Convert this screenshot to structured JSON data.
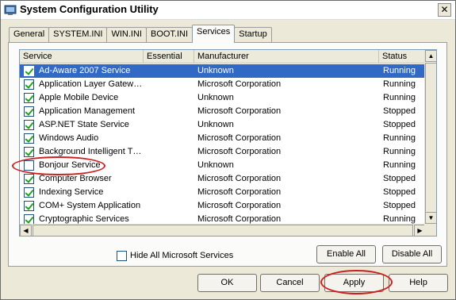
{
  "window": {
    "title": "System Configuration Utility",
    "close_glyph": "✕"
  },
  "tabs": [
    {
      "label": "General"
    },
    {
      "label": "SYSTEM.INI"
    },
    {
      "label": "WIN.INI"
    },
    {
      "label": "BOOT.INI"
    },
    {
      "label": "Services",
      "active": true
    },
    {
      "label": "Startup"
    }
  ],
  "list": {
    "columns": {
      "service": "Service",
      "essential": "Essential",
      "manufacturer": "Manufacturer",
      "status": "Status"
    },
    "rows": [
      {
        "checked": true,
        "service": "Ad-Aware 2007 Service",
        "manufacturer": "Unknown",
        "status": "Running",
        "selected": true
      },
      {
        "checked": true,
        "service": "Application Layer Gatew…",
        "manufacturer": "Microsoft Corporation",
        "status": "Running"
      },
      {
        "checked": true,
        "service": "Apple Mobile Device",
        "manufacturer": "Unknown",
        "status": "Running"
      },
      {
        "checked": true,
        "service": "Application Management",
        "manufacturer": "Microsoft Corporation",
        "status": "Stopped"
      },
      {
        "checked": true,
        "service": "ASP.NET State Service",
        "manufacturer": "Unknown",
        "status": "Stopped"
      },
      {
        "checked": true,
        "service": "Windows Audio",
        "manufacturer": "Microsoft Corporation",
        "status": "Running"
      },
      {
        "checked": true,
        "service": "Background Intelligent T…",
        "manufacturer": "Microsoft Corporation",
        "status": "Running"
      },
      {
        "checked": false,
        "service": "Bonjour Service",
        "manufacturer": "Unknown",
        "status": "Running"
      },
      {
        "checked": true,
        "service": "Computer Browser",
        "manufacturer": "Microsoft Corporation",
        "status": "Stopped"
      },
      {
        "checked": true,
        "service": "Indexing Service",
        "manufacturer": "Microsoft Corporation",
        "status": "Stopped"
      },
      {
        "checked": true,
        "service": "COM+ System Application",
        "manufacturer": "Microsoft Corporation",
        "status": "Stopped"
      },
      {
        "checked": true,
        "service": "Cryptographic Services",
        "manufacturer": "Microsoft Corporation",
        "status": "Running"
      }
    ],
    "scroll": {
      "up": "▲",
      "down": "▼",
      "left": "◀",
      "right": "▶"
    }
  },
  "options": {
    "hide_ms_label": "Hide All Microsoft Services",
    "hide_ms_checked": false
  },
  "buttons": {
    "enable_all": "Enable All",
    "disable_all": "Disable All",
    "ok": "OK",
    "cancel": "Cancel",
    "apply": "Apply",
    "help": "Help"
  },
  "colors": {
    "selection": "#316ac5",
    "annotation": "#cc2020",
    "check": "#21a121"
  }
}
